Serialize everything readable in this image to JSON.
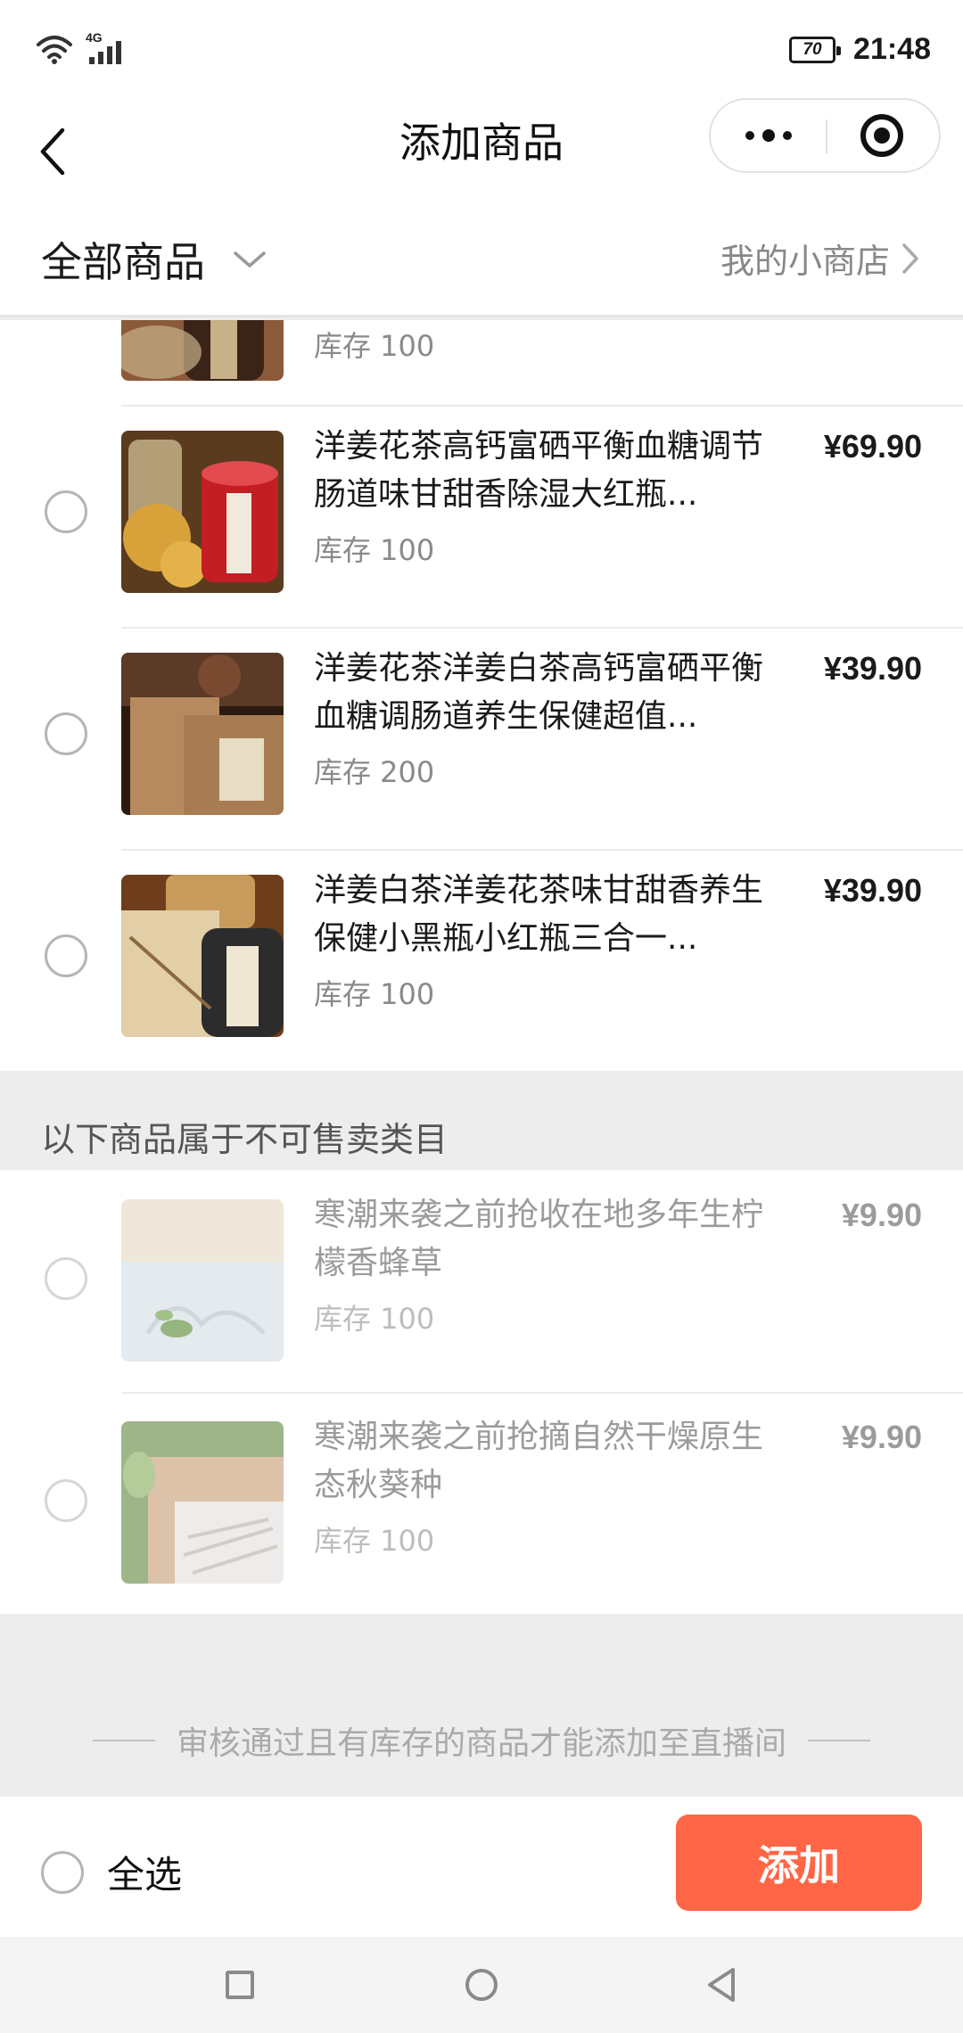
{
  "status_bar": {
    "network": "4G",
    "battery": "70",
    "time": "21:48"
  },
  "nav": {
    "title": "添加商品"
  },
  "filter": {
    "category_label": "全部商品",
    "shop_link": "我的小商店"
  },
  "products": [
    {
      "title": "",
      "stock": "库存 100",
      "price": "",
      "thumb_colors": [
        "#8a5a3a",
        "#3a2418",
        "#c8b089"
      ]
    },
    {
      "title": "洋姜花茶高钙富硒平衡血糖调节肠道味甘甜香除湿大红瓶...",
      "stock": "库存 100",
      "price": "¥69.90",
      "thumb_colors": [
        "#d9a13a",
        "#c21e24",
        "#5a3b1e"
      ]
    },
    {
      "title": "洋姜花茶洋姜白茶高钙富硒平衡血糖调肠道养生保健超值...",
      "stock": "库存 200",
      "price": "¥39.90",
      "thumb_colors": [
        "#b68a5e",
        "#5b3a28",
        "#2a1a10"
      ]
    },
    {
      "title": "洋姜白茶洋姜花茶味甘甜香养生保健小黑瓶小红瓶三合一...",
      "stock": "库存 100",
      "price": "¥39.90",
      "thumb_colors": [
        "#c89a5c",
        "#2c2c2c",
        "#e2cfa8"
      ]
    }
  ],
  "restricted_section": {
    "header": "以下商品属于不可售卖类目",
    "products": [
      {
        "title": "寒潮来袭之前抢收在地多年生柠檬香蜂草",
        "stock": "库存 100",
        "price": "¥9.90",
        "thumb_colors": [
          "#e8dcc7",
          "#d6e0e6",
          "#5f8f3e"
        ]
      },
      {
        "title": "寒潮来袭之前抢摘自然干燥原生态秋葵种",
        "stock": "库存 100",
        "price": "¥9.90",
        "thumb_colors": [
          "#c9a37a",
          "#6b8f4b",
          "#e6e3df"
        ]
      }
    ]
  },
  "notice": "审核通过且有库存的商品才能添加至直播间",
  "action_bar": {
    "select_all": "全选",
    "add_button": "添加",
    "accent_color": "#ff6646"
  },
  "icons": {
    "back": "chevron-left-icon",
    "more": "more-dots-icon",
    "target": "target-icon",
    "dropdown": "chevron-down-icon",
    "shop_link": "chevron-right-icon",
    "wifi": "wifi-icon",
    "signal": "signal-icon"
  }
}
